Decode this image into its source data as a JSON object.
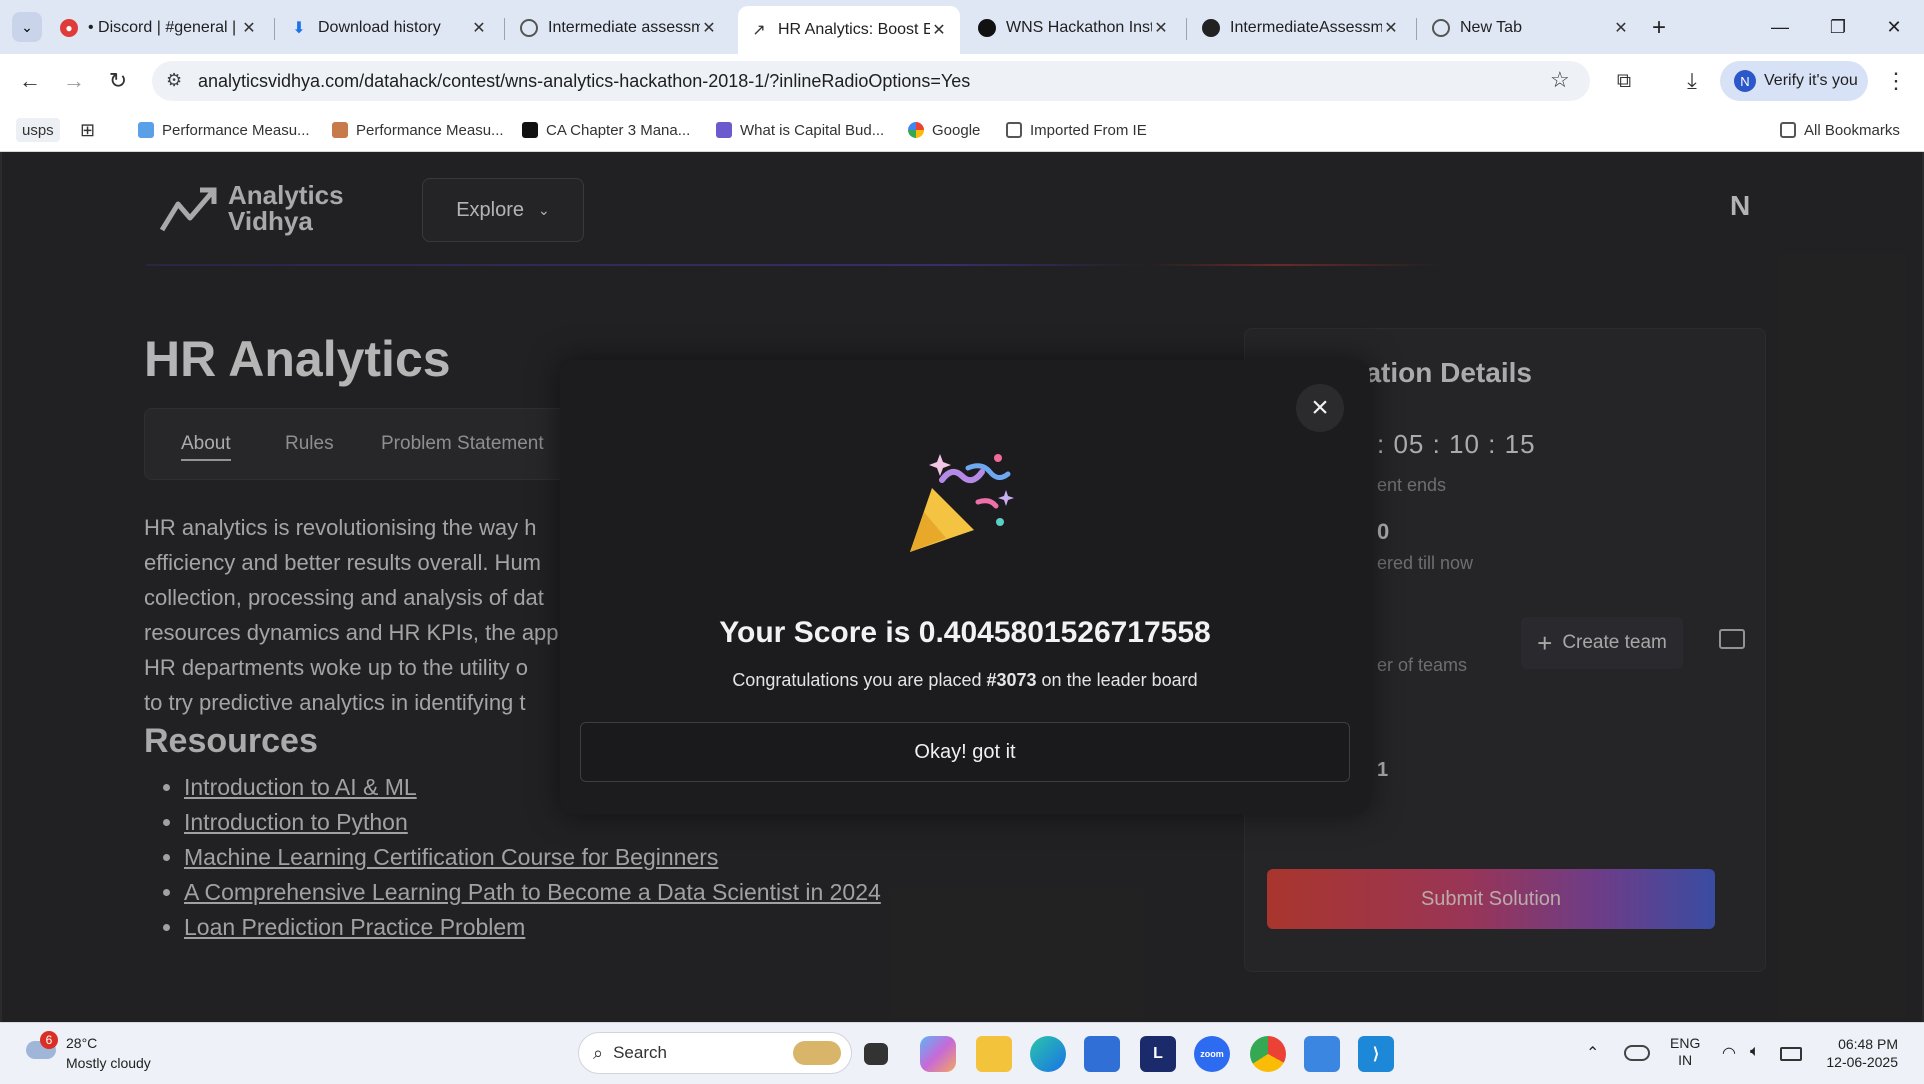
{
  "browser": {
    "tabs": [
      {
        "label": "• Discord | #general |",
        "icon": "discord-icon",
        "active": false
      },
      {
        "label": "Download history",
        "icon": "download-icon",
        "active": false
      },
      {
        "label": "Intermediate assessm",
        "icon": "globe-icon",
        "active": false
      },
      {
        "label": "HR Analytics: Boost E",
        "icon": "analytics-vidhya-icon",
        "active": true
      },
      {
        "label": "WNS Hackathon Inst",
        "icon": "openai-icon",
        "active": false
      },
      {
        "label": "IntermediateAssessm",
        "icon": "github-icon",
        "active": false
      },
      {
        "label": "New Tab",
        "icon": "globe-icon",
        "active": false
      }
    ],
    "url": "analyticsvidhya.com/datahack/contest/wns-analytics-hackathon-2018-1/?inlineRadioOptions=Yes",
    "verify_label": "Verify it's you",
    "profile_initial": "N",
    "bookmarks": [
      {
        "label": "usps"
      },
      {
        "label": "Performance Measu..."
      },
      {
        "label": "Performance Measu..."
      },
      {
        "label": "CA Chapter 3 Mana..."
      },
      {
        "label": "What is Capital Bud..."
      },
      {
        "label": "Google"
      },
      {
        "label": "Imported From IE"
      }
    ],
    "all_bookmarks": "All Bookmarks"
  },
  "site": {
    "logo_line1": "Analytics",
    "logo_line2": "Vidhya",
    "explore": "Explore",
    "user_initial": "N",
    "title": "HR Analytics",
    "tabs": [
      "About",
      "Rules",
      "Problem Statement"
    ],
    "about_lines": [
      "HR analytics is revolutionising the way h",
      "efficiency and better results overall. Hum",
      "collection, processing and analysis of dat",
      "resources dynamics and HR KPIs, the app",
      "HR departments woke up to the utility o",
      "to try predictive analytics in identifying t"
    ],
    "resources_heading": "Resources",
    "resources": [
      "Introduction to AI & ML",
      "Introduction to Python",
      "Machine Learning Certification Course for Beginners",
      "A Comprehensive Learning Path to Become a Data Scientist in 2024",
      "Loan Prediction Practice Problem"
    ],
    "registration": {
      "title": "Registration Details",
      "timer": ": 05 : 10 : 15",
      "timer_caption": "ent ends",
      "registered_value": "0",
      "registered_caption": "ered till now",
      "teams_caption": "er of teams",
      "create_team": "Create team",
      "rank_fragment": "1",
      "submit": "Submit Solution"
    }
  },
  "modal": {
    "score_text": "Your Score is 0.4045801526717558",
    "congrats_prefix": "Congratulations you are placed ",
    "rank": "#3073",
    "congrats_suffix": " on the leader board",
    "button": "Okay! got it"
  },
  "taskbar": {
    "temp": "28°C",
    "weather": "Mostly cloudy",
    "weather_badge": "6",
    "search": "Search",
    "lang1": "ENG",
    "lang2": "IN",
    "time": "06:48 PM",
    "date": "12-06-2025"
  }
}
